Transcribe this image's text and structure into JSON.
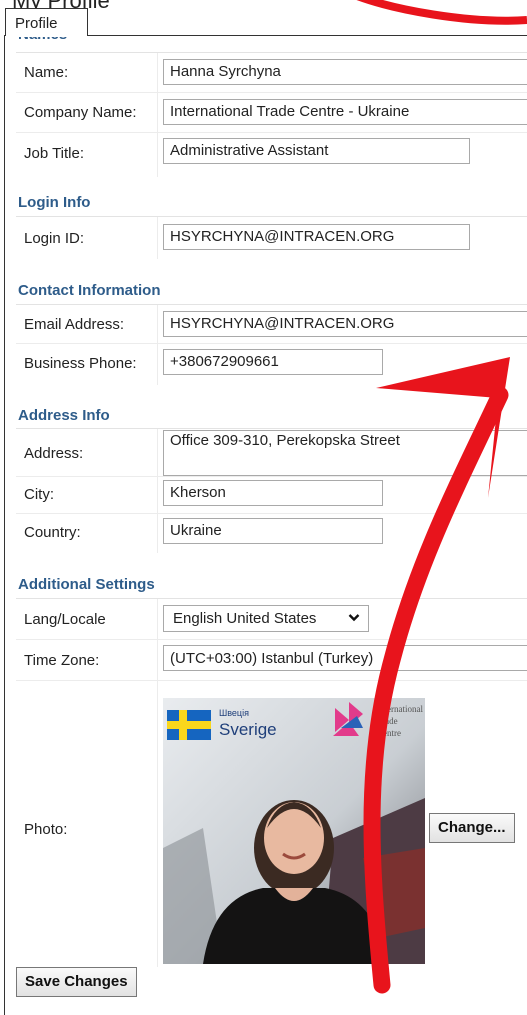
{
  "page": {
    "title": "My Profile",
    "tab_label": "Profile"
  },
  "sections": {
    "names": "Names",
    "login": "Login Info",
    "contact": "Contact Information",
    "address": "Address Info",
    "additional": "Additional Settings"
  },
  "fields": {
    "name": {
      "label": "Name:",
      "value": "Hanna Syrchyna"
    },
    "company": {
      "label": "Company Name:",
      "value": "International Trade Centre - Ukraine"
    },
    "job_title": {
      "label": "Job Title:",
      "value": "Administrative Assistant"
    },
    "login_id": {
      "label": "Login ID:",
      "value": "HSYRCHYNA@INTRACEN.ORG"
    },
    "email": {
      "label": "Email Address:",
      "value": "HSYRCHYNA@INTRACEN.ORG"
    },
    "phone": {
      "label": "Business Phone:",
      "value": "+380672909661"
    },
    "address": {
      "label": "Address:",
      "value": "Office 309-310, Perekopska Street"
    },
    "city": {
      "label": "City:",
      "value": "Kherson"
    },
    "country": {
      "label": "Country:",
      "value": "Ukraine"
    },
    "locale": {
      "label": "Lang/Locale",
      "value": "English United States"
    },
    "timezone": {
      "label": "Time Zone:",
      "value": "(UTC+03:00) Istanbul (Turkey)"
    },
    "photo": {
      "label": "Photo:"
    }
  },
  "photo_banner": {
    "sverige_small": "Швеція",
    "sverige": "Sverige",
    "itc_line1": "International",
    "itc_line2": "Trade",
    "itc_line3": "Centre"
  },
  "buttons": {
    "change": "Change...",
    "save": "Save Changes"
  },
  "colors": {
    "section_heading": "#2e5c8a",
    "annotation": "#e8141c"
  }
}
